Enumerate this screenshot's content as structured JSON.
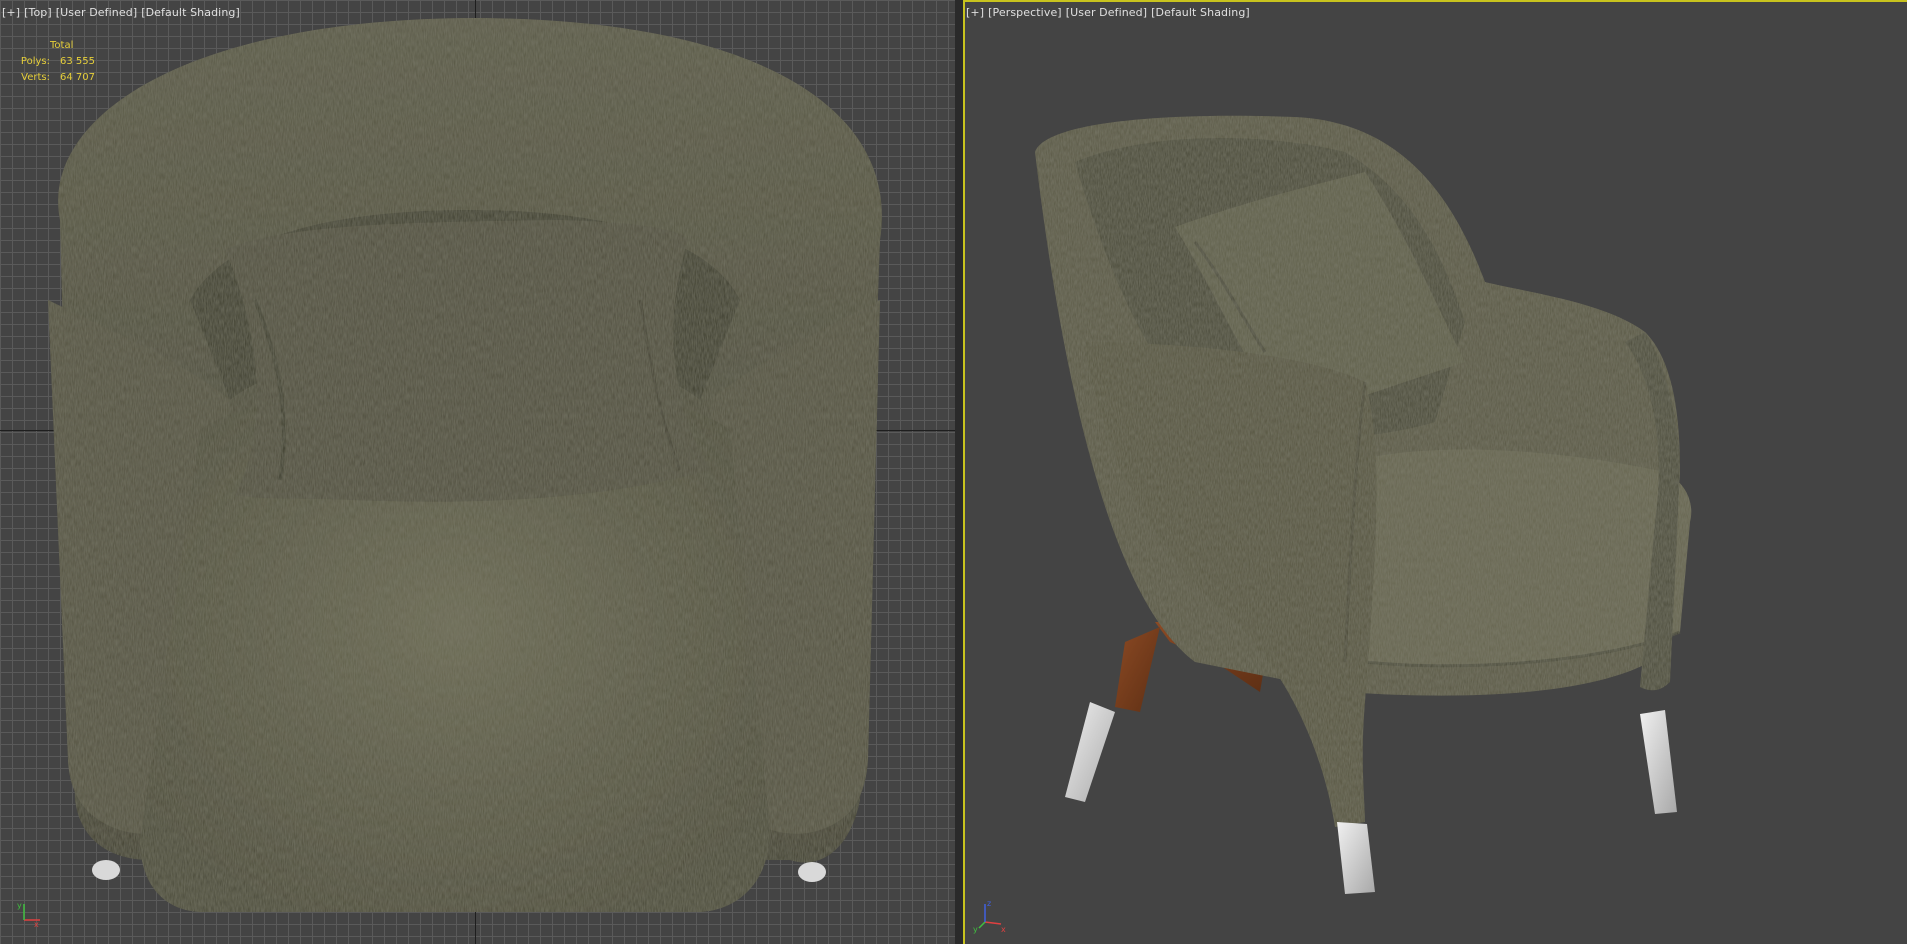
{
  "top_viewport": {
    "label": [
      "[+]",
      "[Top]",
      "[User Defined]",
      "[Default Shading]"
    ],
    "stats": {
      "total_label": "Total",
      "polys_label": "Polys:",
      "polys_value": "63 555",
      "verts_label": "Verts:",
      "verts_value": "64 707"
    }
  },
  "perspective_viewport": {
    "label": [
      "[+]",
      "[Perspective]",
      "[User Defined]",
      "[Default Shading]"
    ]
  },
  "colors": {
    "fabric": "#5d5c48",
    "fabric_dark": "#3c3b2c",
    "fabric_light": "#777560",
    "wood": "#7a3e1e",
    "metal": "#d9d9d9",
    "active_border": "#c8c31e",
    "stats_text": "#e6cf3a"
  },
  "icons": [
    "axis-gizmo-icon"
  ]
}
